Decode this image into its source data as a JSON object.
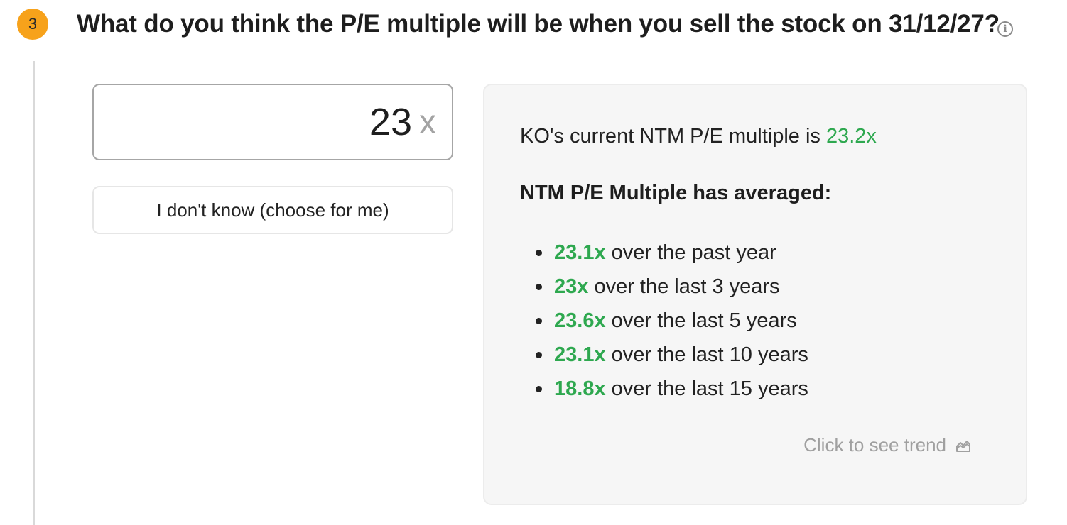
{
  "step": {
    "number": "3"
  },
  "question": {
    "text": "What do you think the P/E multiple will be when you sell the stock on 31/12/27?",
    "info_icon": "info-icon"
  },
  "input": {
    "value": "23",
    "suffix": "x"
  },
  "dont_know_button": {
    "label": "I don't know (choose for me)"
  },
  "panel": {
    "current_prefix": "KO's current NTM P/E multiple is ",
    "current_value": "23.2x",
    "averaged_heading": "NTM P/E Multiple has averaged:",
    "averages": [
      {
        "value": "23.1x",
        "period": " over the past year"
      },
      {
        "value": "23x",
        "period": " over the last 3 years"
      },
      {
        "value": "23.6x",
        "period": " over the last 5 years"
      },
      {
        "value": "23.1x",
        "period": " over the last 10 years"
      },
      {
        "value": "18.8x",
        "period": " over the last 15 years"
      }
    ],
    "trend_link": "Click to see trend",
    "trend_icon": "chart-trend-icon"
  },
  "colors": {
    "accent_green": "#2ea84f",
    "step_badge": "#f7a21b",
    "muted_text": "#a0a0a0"
  }
}
